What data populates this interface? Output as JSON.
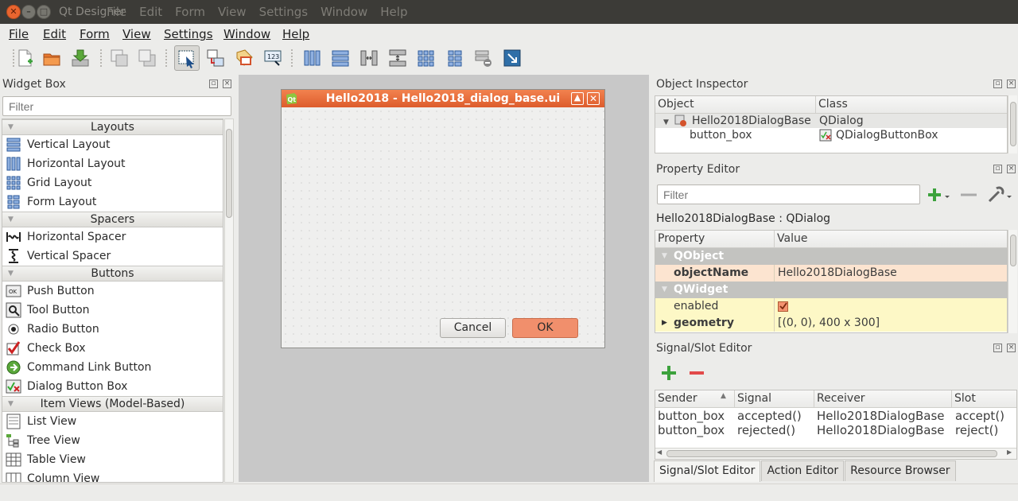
{
  "window": {
    "app_title": "Qt Designer",
    "global_menu": [
      "File",
      "Edit",
      "Form",
      "View",
      "Settings",
      "Window",
      "Help"
    ]
  },
  "menubar": [
    "File",
    "Edit",
    "Form",
    "View",
    "Settings",
    "Window",
    "Help"
  ],
  "toolbar": {
    "icons": [
      "new-form-icon",
      "open-form-icon",
      "save-form-icon",
      "send-to-back-icon",
      "bring-to-front-icon",
      "edit-widgets-icon",
      "edit-signals-slots-icon",
      "edit-buddies-icon",
      "edit-tab-order-icon",
      "layout-horizontal-icon",
      "layout-vertical-icon",
      "layout-horizontal-splitter-icon",
      "layout-vertical-splitter-icon",
      "layout-grid-icon",
      "layout-form-icon",
      "break-layout-icon",
      "adjust-size-icon"
    ]
  },
  "widget_box": {
    "title": "Widget Box",
    "filter_placeholder": "Filter",
    "categories": [
      {
        "name": "Layouts",
        "items": [
          "Vertical Layout",
          "Horizontal Layout",
          "Grid Layout",
          "Form Layout"
        ]
      },
      {
        "name": "Spacers",
        "items": [
          "Horizontal Spacer",
          "Vertical Spacer"
        ]
      },
      {
        "name": "Buttons",
        "items": [
          "Push Button",
          "Tool Button",
          "Radio Button",
          "Check Box",
          "Command Link Button",
          "Dialog Button Box"
        ]
      },
      {
        "name": "Item Views (Model-Based)",
        "items": [
          "List View",
          "Tree View",
          "Table View",
          "Column View"
        ]
      }
    ]
  },
  "form": {
    "title": "Hello2018 - Hello2018_dialog_base.ui",
    "cancel": "Cancel",
    "ok": "OK"
  },
  "object_inspector": {
    "title": "Object Inspector",
    "columns": [
      "Object",
      "Class"
    ],
    "rows": [
      {
        "object": "Hello2018DialogBase",
        "class": "QDialog"
      },
      {
        "object": "button_box",
        "class": "QDialogButtonBox"
      }
    ]
  },
  "property_editor": {
    "title": "Property Editor",
    "filter_placeholder": "Filter",
    "class_label": "Hello2018DialogBase : QDialog",
    "columns": [
      "Property",
      "Value"
    ],
    "groups": [
      {
        "name": "QObject",
        "props": [
          {
            "name": "objectName",
            "value": "Hello2018DialogBase",
            "bold": true
          }
        ]
      },
      {
        "name": "QWidget",
        "props": [
          {
            "name": "enabled",
            "value": "",
            "checked": true
          },
          {
            "name": "geometry",
            "value": "[(0, 0), 400 x 300]",
            "bold": true
          }
        ]
      }
    ]
  },
  "signal_slot_editor": {
    "title": "Signal/Slot Editor",
    "columns": [
      "Sender",
      "Signal",
      "Receiver",
      "Slot"
    ],
    "rows": [
      {
        "sender": "button_box",
        "signal": "accepted()",
        "receiver": "Hello2018DialogBase",
        "slot": "accept()"
      },
      {
        "sender": "button_box",
        "signal": "rejected()",
        "receiver": "Hello2018DialogBase",
        "slot": "reject()"
      }
    ]
  },
  "bottom_tabs": [
    "Signal/Slot Editor",
    "Action Editor",
    "Resource Browser"
  ],
  "colors": {
    "accent": "#e9652f",
    "form_title": "#e66a38",
    "ok_button": "#f18f6c"
  }
}
